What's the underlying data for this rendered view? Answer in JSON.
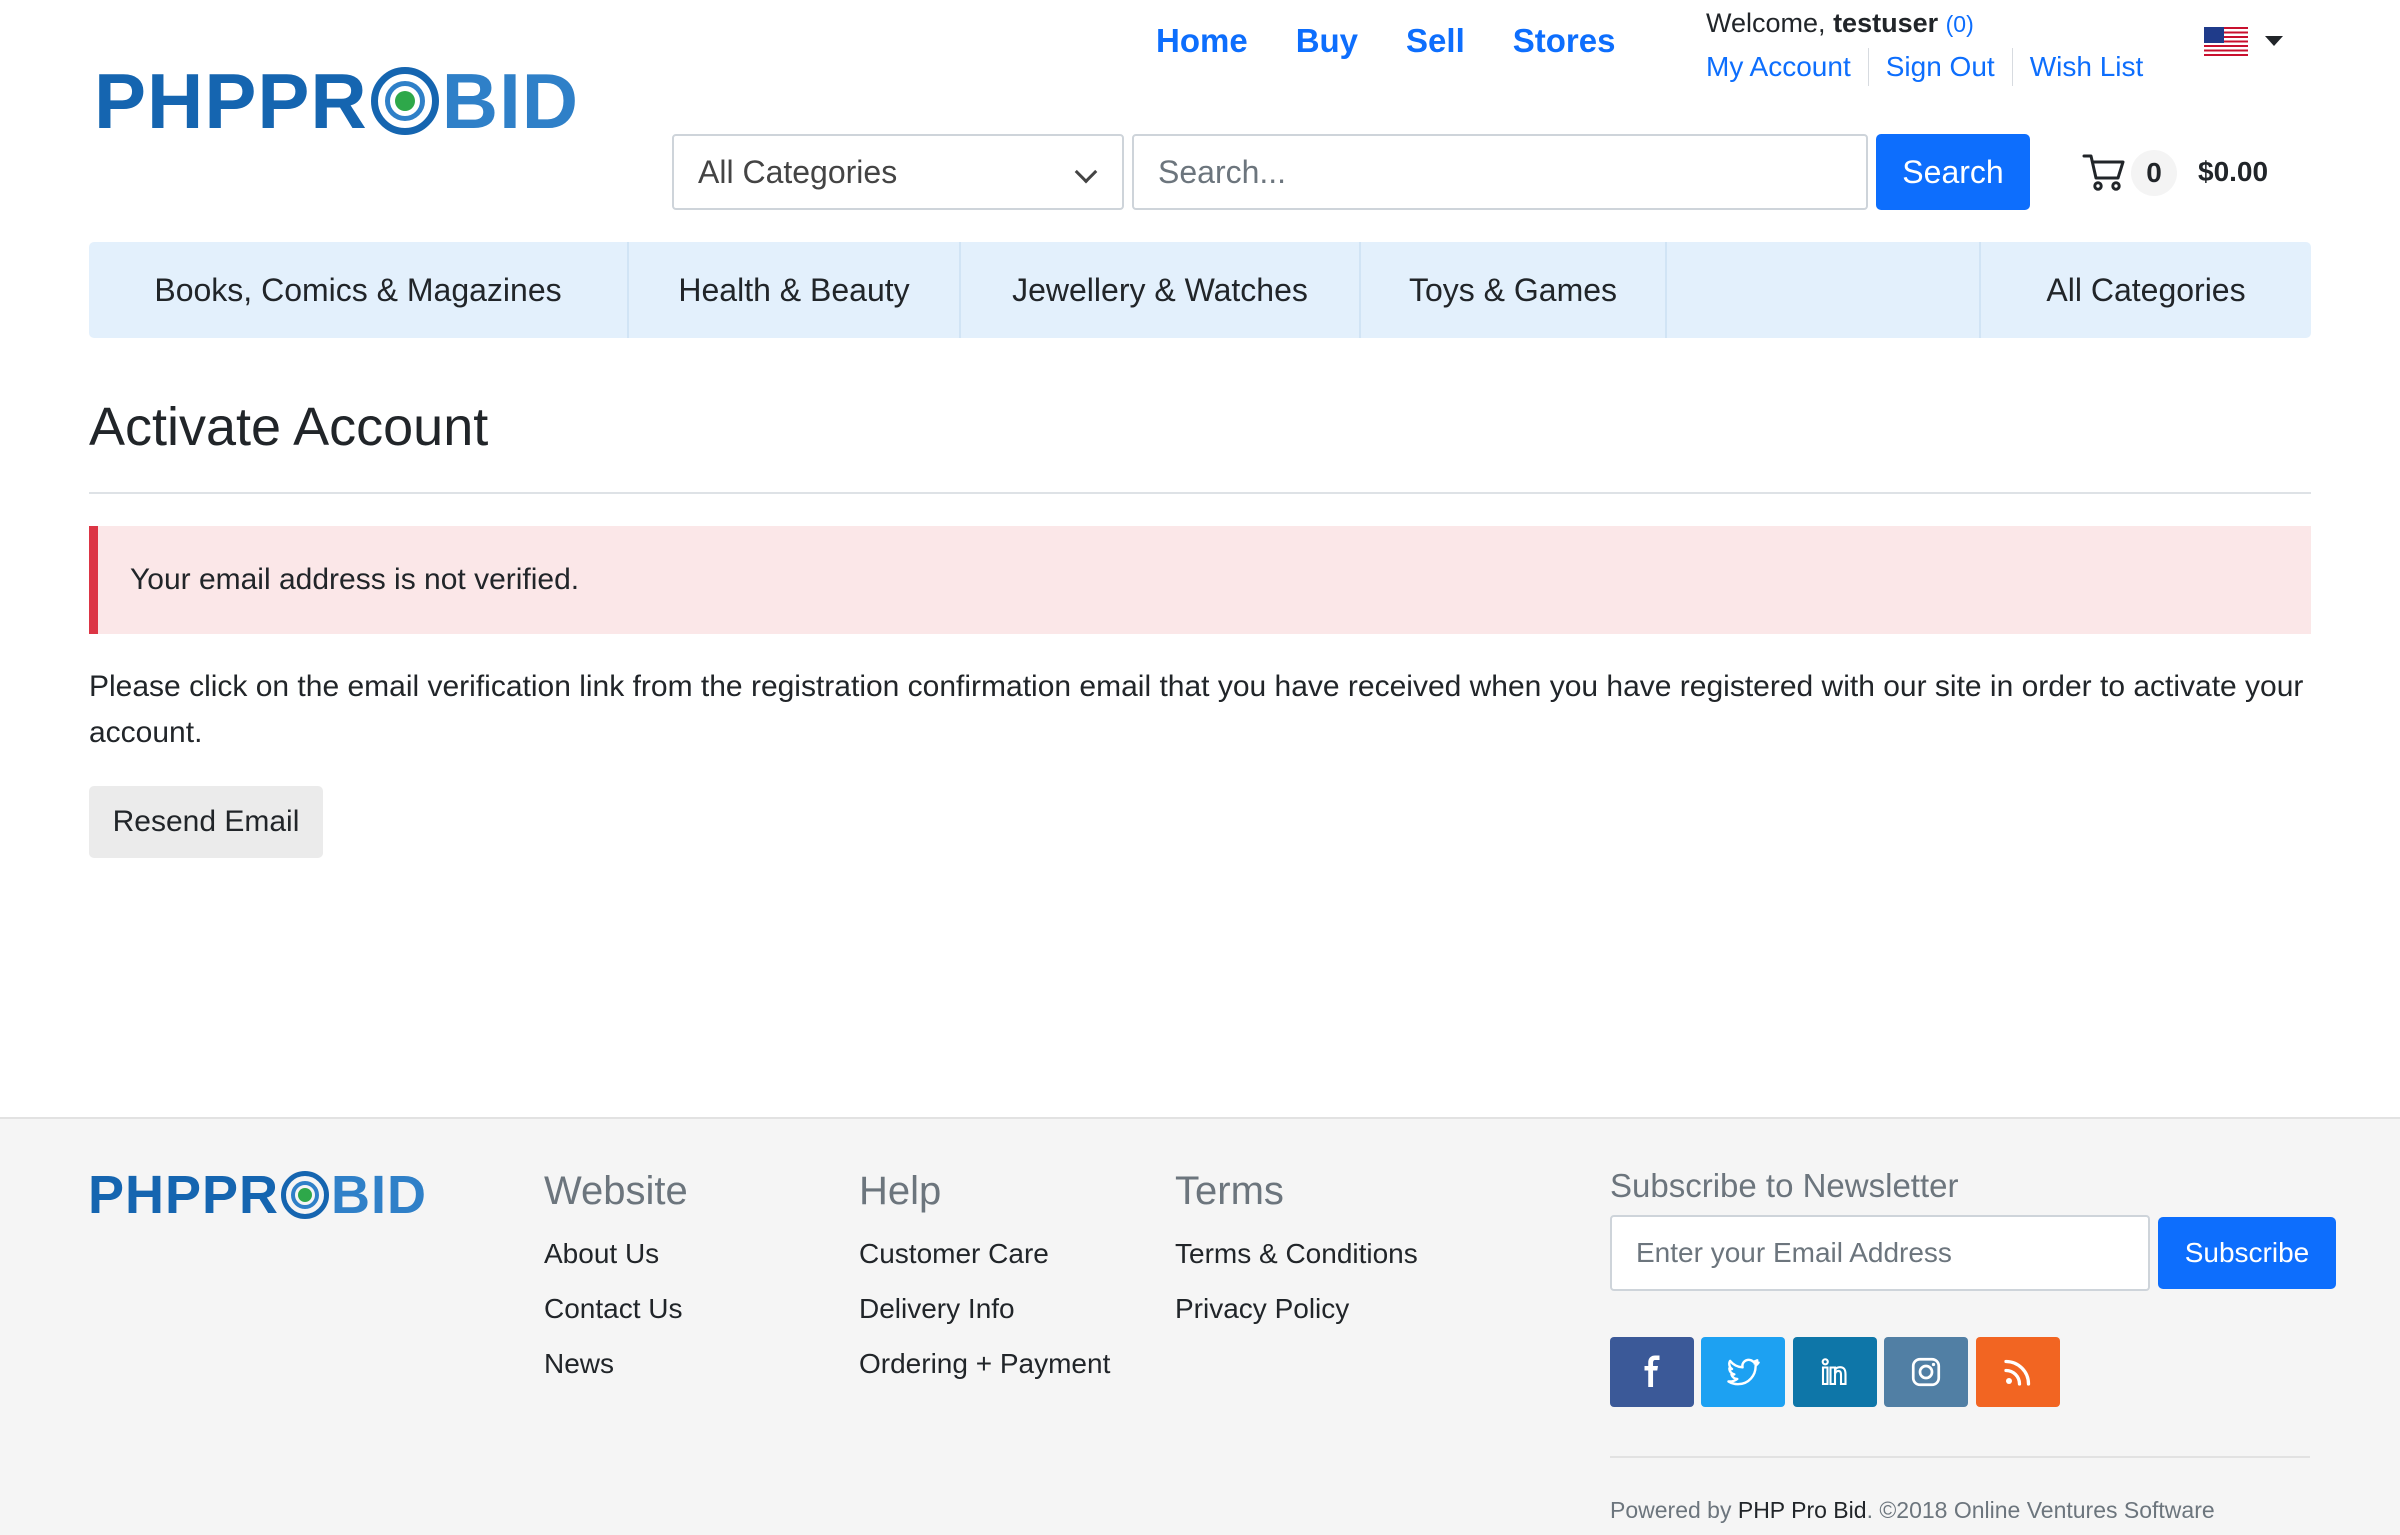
{
  "header": {
    "logo_left": "PHPPR",
    "logo_right": "BID",
    "nav": [
      "Home",
      "Buy",
      "Sell",
      "Stores"
    ],
    "welcome_prefix": "Welcome,",
    "username": "testuser",
    "message_count": "(0)",
    "account_links": [
      "My Account",
      "Sign Out",
      "Wish List"
    ],
    "language_flag": "us-flag-icon",
    "category_select": "All Categories",
    "search_placeholder": "Search...",
    "search_button": "Search",
    "cart_count": "0",
    "cart_total": "$0.00"
  },
  "categories": {
    "items": [
      "Books, Comics & Magazines",
      "Health & Beauty",
      "Jewellery & Watches",
      "Toys & Games"
    ],
    "all": "All Categories"
  },
  "main": {
    "title": "Activate Account",
    "alert": "Your email address is not verified.",
    "body": "Please click on the email verification link from the registration confirmation email that you have received when you have registered with our site in order to activate your account.",
    "resend_button": "Resend Email"
  },
  "footer": {
    "logo_left": "PHPPR",
    "logo_right": "BID",
    "columns": [
      {
        "title": "Website",
        "links": [
          "About Us",
          "Contact Us",
          "News"
        ]
      },
      {
        "title": "Help",
        "links": [
          "Customer Care",
          "Delivery Info",
          "Ordering + Payment"
        ]
      },
      {
        "title": "Terms",
        "links": [
          "Terms & Conditions",
          "Privacy Policy"
        ]
      }
    ],
    "newsletter_title": "Subscribe to Newsletter",
    "email_placeholder": "Enter your Email Address",
    "subscribe_button": "Subscribe",
    "social": [
      {
        "icon": "facebook-icon",
        "color": "#3b5998"
      },
      {
        "icon": "twitter-icon",
        "color": "#1da1f2"
      },
      {
        "icon": "linkedin-icon",
        "color": "#0e76a8"
      },
      {
        "icon": "instagram-icon",
        "color": "#517fa4"
      },
      {
        "icon": "rss-icon",
        "color": "#f26522"
      }
    ],
    "powered_prefix": "Powered by",
    "powered_brand": "PHP Pro Bid",
    "powered_suffix": ". ©2018 Online Ventures Software"
  },
  "colors": {
    "primary": "#0d6efd",
    "brand": "#1565b0",
    "alert_border": "#dc3545",
    "alert_bg": "#fbe7e8",
    "category_bar": "#e3f0fc"
  }
}
